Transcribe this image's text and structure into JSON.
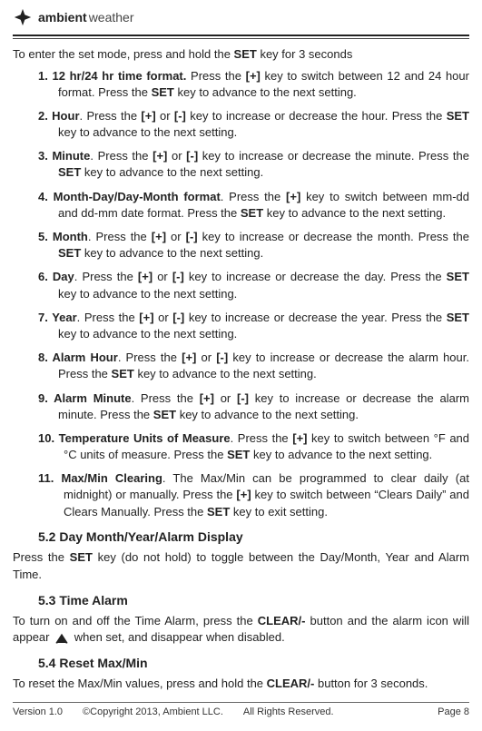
{
  "brand": {
    "bold": "ambient",
    "light": "weather"
  },
  "intro": {
    "prefix": "To enter the set mode, press and hold the ",
    "key": "SET",
    "suffix": " key for 3 seconds"
  },
  "steps": [
    {
      "num": "1. ",
      "title": "12 hr/24 hr time format.",
      "t1": "  Press the ",
      "k1": "[+]",
      "t2": " key to switch between 12 and 24 hour format. Press the ",
      "k2": "SET",
      "t3": " key to advance to the next setting."
    },
    {
      "num": "2. ",
      "title": "Hour",
      "t1": ". Press the ",
      "k1": "[+]",
      "t2": " or ",
      "k2": "[-]",
      "t3": " key to increase or decrease the hour.  Press the ",
      "k3": "SET",
      "t4": " key to advance to the next setting."
    },
    {
      "num": "3. ",
      "title": "Minute",
      "t1": ". Press the ",
      "k1": "[+]",
      "t2": " or ",
      "k2": "[-]",
      "t3": " key to increase or decrease the minute.  Press the ",
      "k3": "SET",
      "t4": " key to advance to the next setting."
    },
    {
      "num": "4. ",
      "title": "Month-Day/Day-Month format",
      "t1": ". Press the ",
      "k1": "[+]",
      "t2": " key to switch between mm-dd and dd-mm date format. Press the ",
      "k2": "SET",
      "t3": " key to advance to the next setting."
    },
    {
      "num": "5. ",
      "title": "Month",
      "t1": ". Press the ",
      "k1": "[+]",
      "t2": " or ",
      "k2": "[-]",
      "t3": " key to increase or decrease the month.  Press the ",
      "k3": "SET",
      "t4": " key to advance to the next setting."
    },
    {
      "num": "6. ",
      "title": "Day",
      "t1": ". Press the ",
      "k1": "[+]",
      "t2": " or ",
      "k2": "[-]",
      "t3": " key to increase or decrease the day.  Press the ",
      "k3": "SET",
      "t4": " key to advance to the next setting."
    },
    {
      "num": "7. ",
      "title": "Year",
      "t1": ". Press the ",
      "k1": "[+]",
      "t2": " or ",
      "k2": "[-]",
      "t3": " key to increase or decrease the year.  Press the ",
      "k3": "SET",
      "t4": " key to advance to the next setting."
    },
    {
      "num": "8. ",
      "title": "Alarm Hour",
      "t1": ". Press the ",
      "k1": "[+]",
      "t2": " or ",
      "k2": "[-]",
      "t3": " key to increase or decrease the alarm hour.  Press the ",
      "k3": "SET",
      "t4": " key to advance to the next setting."
    },
    {
      "num": "9. ",
      "title": "Alarm Minute",
      "t1": ". Press the ",
      "k1": "[+]",
      "t2": " or ",
      "k2": "[-]",
      "t3": " key to increase or decrease the alarm minute.  Press the ",
      "k3": "SET",
      "t4": " key to advance to the next setting."
    },
    {
      "num": "10. ",
      "title": "Temperature Units of Measure",
      "t1": ". Press the ",
      "k1": "[+]",
      "t2": " key to switch between °F and °C units of measure. Press the ",
      "k2": "SET",
      "t3": " key to advance to the next setting."
    },
    {
      "num": "11. ",
      "title": "Max/Min Clearing",
      "t1": ".  The Max/Min can be programmed to clear daily (at midnight) or manually. Press the  ",
      "k1": "[+]",
      "t2": " key to switch between “Clears Daily” and Clears Manually. Press the ",
      "k2": "SET",
      "t3": " key to exit setting."
    }
  ],
  "sec52": {
    "head": "5.2 Day Month/Year/Alarm Display",
    "p1a": "Press the ",
    "p1k": "SET",
    "p1b": " key (do not hold) to toggle between the Day/Month, Year and Alarm Time."
  },
  "sec53": {
    "head": "5.3 Time Alarm",
    "p1a": "To turn on and off the Time Alarm, press the ",
    "p1k": "CLEAR/-",
    "p1b": " button and the alarm icon will appear ",
    "p1c": " when set, and disappear when disabled."
  },
  "sec54": {
    "head": "5.4 Reset Max/Min",
    "p1a": "To reset the Max/Min values, press and hold the ",
    "p1k": "CLEAR/-",
    "p1b": " button for 3 seconds."
  },
  "footer": {
    "version": "Version 1.0",
    "copyright": "©Copyright 2013, Ambient  LLC.",
    "rights": "All Rights Reserved.",
    "page": "Page 8"
  }
}
